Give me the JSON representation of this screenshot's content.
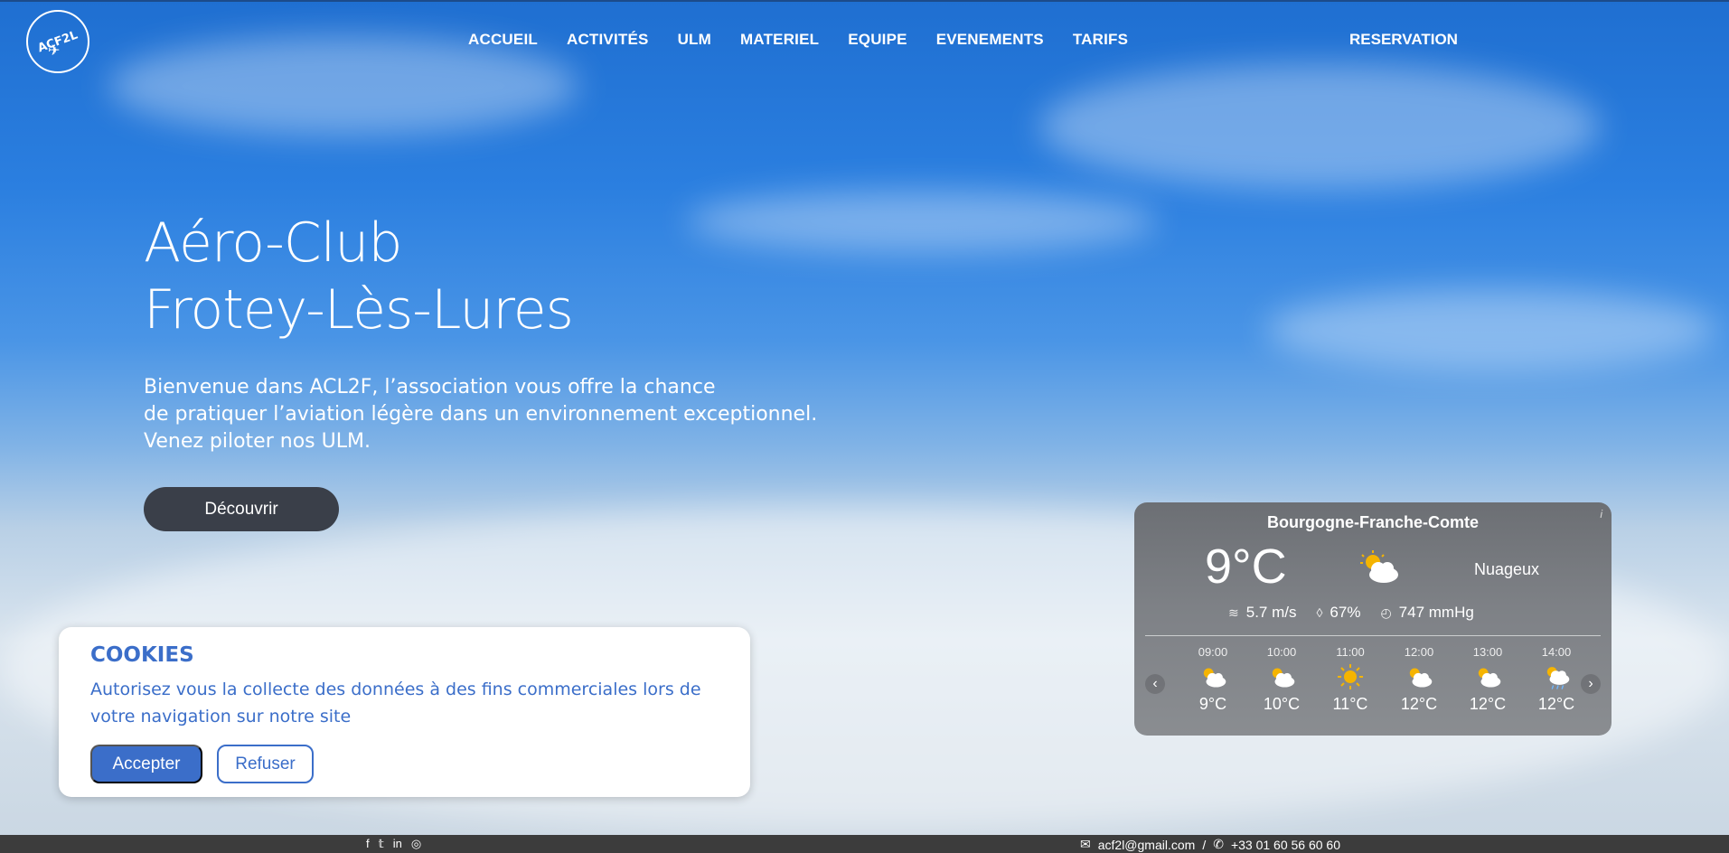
{
  "header": {
    "logo_text": "ACF2L",
    "nav": [
      {
        "label": "ACCUEIL"
      },
      {
        "label": "ACTIVITÉS"
      },
      {
        "label": "ULM"
      },
      {
        "label": "MATERIEL"
      },
      {
        "label": "EQUIPE"
      },
      {
        "label": "EVENEMENTS"
      },
      {
        "label": "TARIFS"
      }
    ],
    "reservation": "RESERVATION"
  },
  "hero": {
    "title_line1": "Aéro-Club",
    "title_line2": "Frotey-Lès-Lures",
    "text_line1": "Bienvenue dans ACL2F, l’association vous offre la chance",
    "text_line2": "de pratiquer l’aviation légère dans un environnement exceptionnel.",
    "text_line3": "Venez piloter nos ULM.",
    "button": "Découvrir"
  },
  "cookies": {
    "title": "COOKIES",
    "text": "Autorisez vous la collecte des données à des fins commerciales lors de votre navigation sur notre site",
    "accept": "Accepter",
    "refuse": "Refuser"
  },
  "weather": {
    "info": "i",
    "region": "Bourgogne-Franche-Comte",
    "temp": "9°C",
    "condition": "Nuageux",
    "condition_icon": "partly-cloudy-icon",
    "wind": "5.7 m/s",
    "humidity": "67%",
    "pressure": "747 mmHg",
    "prev": "‹",
    "next": "›",
    "hours": [
      {
        "time": "09:00",
        "temp": "9°C",
        "icon": "partly-cloudy-icon"
      },
      {
        "time": "10:00",
        "temp": "10°C",
        "icon": "partly-cloudy-icon"
      },
      {
        "time": "11:00",
        "temp": "11°C",
        "icon": "sun-icon"
      },
      {
        "time": "12:00",
        "temp": "12°C",
        "icon": "partly-cloudy-icon"
      },
      {
        "time": "13:00",
        "temp": "12°C",
        "icon": "partly-cloudy-icon"
      },
      {
        "time": "14:00",
        "temp": "12°C",
        "icon": "rain-icon"
      }
    ]
  },
  "footer": {
    "socials": [
      "facebook-icon",
      "twitter-icon",
      "linkedin-icon",
      "instagram-icon"
    ],
    "email": "acf2l@gmail.com",
    "separator": "/",
    "phone": "+33 01 60 56 60 60"
  },
  "colors": {
    "accent": "#3b6ec9",
    "button_dark": "#3a3f49",
    "footer_bg": "#3c3c3c"
  }
}
